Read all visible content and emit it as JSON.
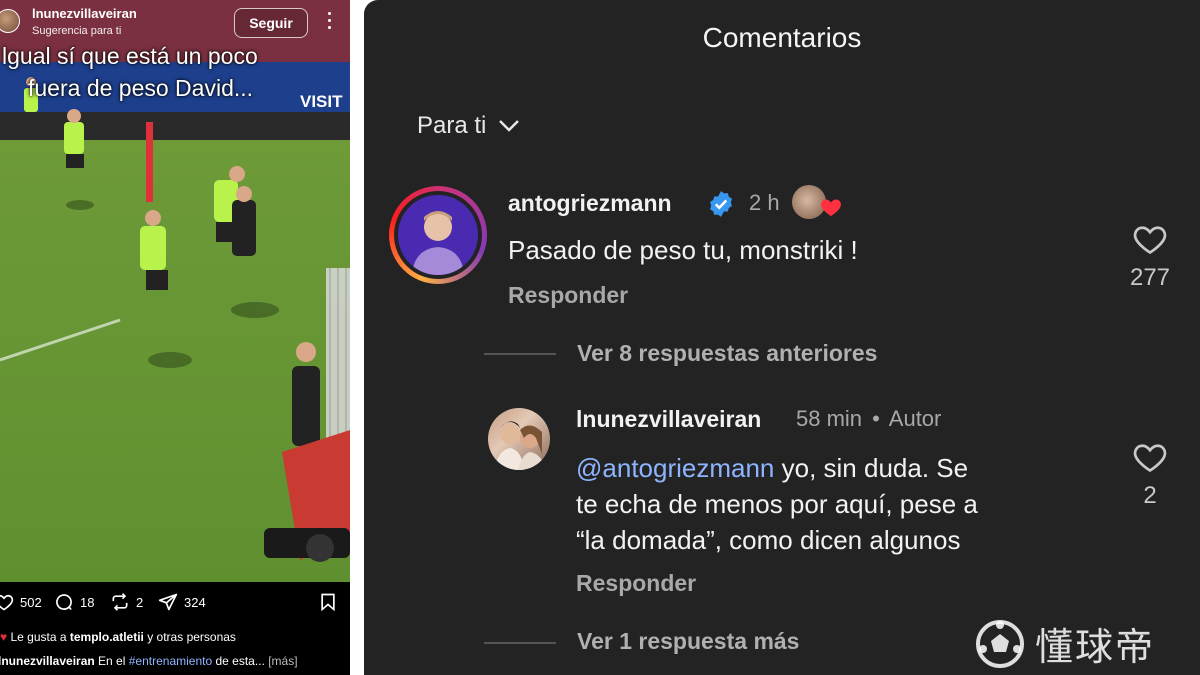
{
  "post": {
    "username": "lnunezvillaveiran",
    "subtitle": "Sugerencia para ti",
    "follow_label": "Seguir",
    "overlay_lines": [
      "lgual sí que está un poco",
      "fuera de peso David..."
    ],
    "banner_text": "VISIT",
    "actions": {
      "likes": "502",
      "comments": "18",
      "reposts": "2",
      "shares": "324"
    },
    "liked_by_prefix": "Le gusta a",
    "liked_by_user": "templo.atletii",
    "liked_by_suffix": "y otras personas",
    "caption_user": "lnunezvillaveiran",
    "caption_text": "En el",
    "caption_tag": "#entrenamiento",
    "caption_rest": "de esta...",
    "caption_more": "[más]"
  },
  "comments": {
    "title": "Comentarios",
    "sort_label": "Para ti",
    "top": {
      "username": "antogriezmann",
      "time": "2 h",
      "text": "Pasado de peso tu, monstriki !",
      "reply_label": "Responder",
      "like_count": "277"
    },
    "view_previous": "Ver 8 respuestas anteriores",
    "reply": {
      "username": "lnunezvillaveiran",
      "time": "58 min",
      "author_sep": "•",
      "author_label": "Autor",
      "mention": "@antogriezmann",
      "text_lines": [
        " yo, sin duda. Se",
        "te echa de menos por aquí, pese a",
        "“la domada”, como dicen algunos"
      ],
      "reply_label": "Responder",
      "like_count": "2"
    },
    "view_more": "Ver 1 respuesta más"
  },
  "watermark": {
    "text": "懂球帝"
  },
  "colors": {
    "panel_bg": "#232324",
    "mention": "#8fb4ff",
    "verified": "#3897f0",
    "heart_red": "#ff3040"
  },
  "icons": [
    "heart-icon",
    "comment-icon",
    "repost-icon",
    "share-icon",
    "bookmark-icon",
    "verified-icon",
    "chevron-down-icon",
    "more-icon"
  ]
}
